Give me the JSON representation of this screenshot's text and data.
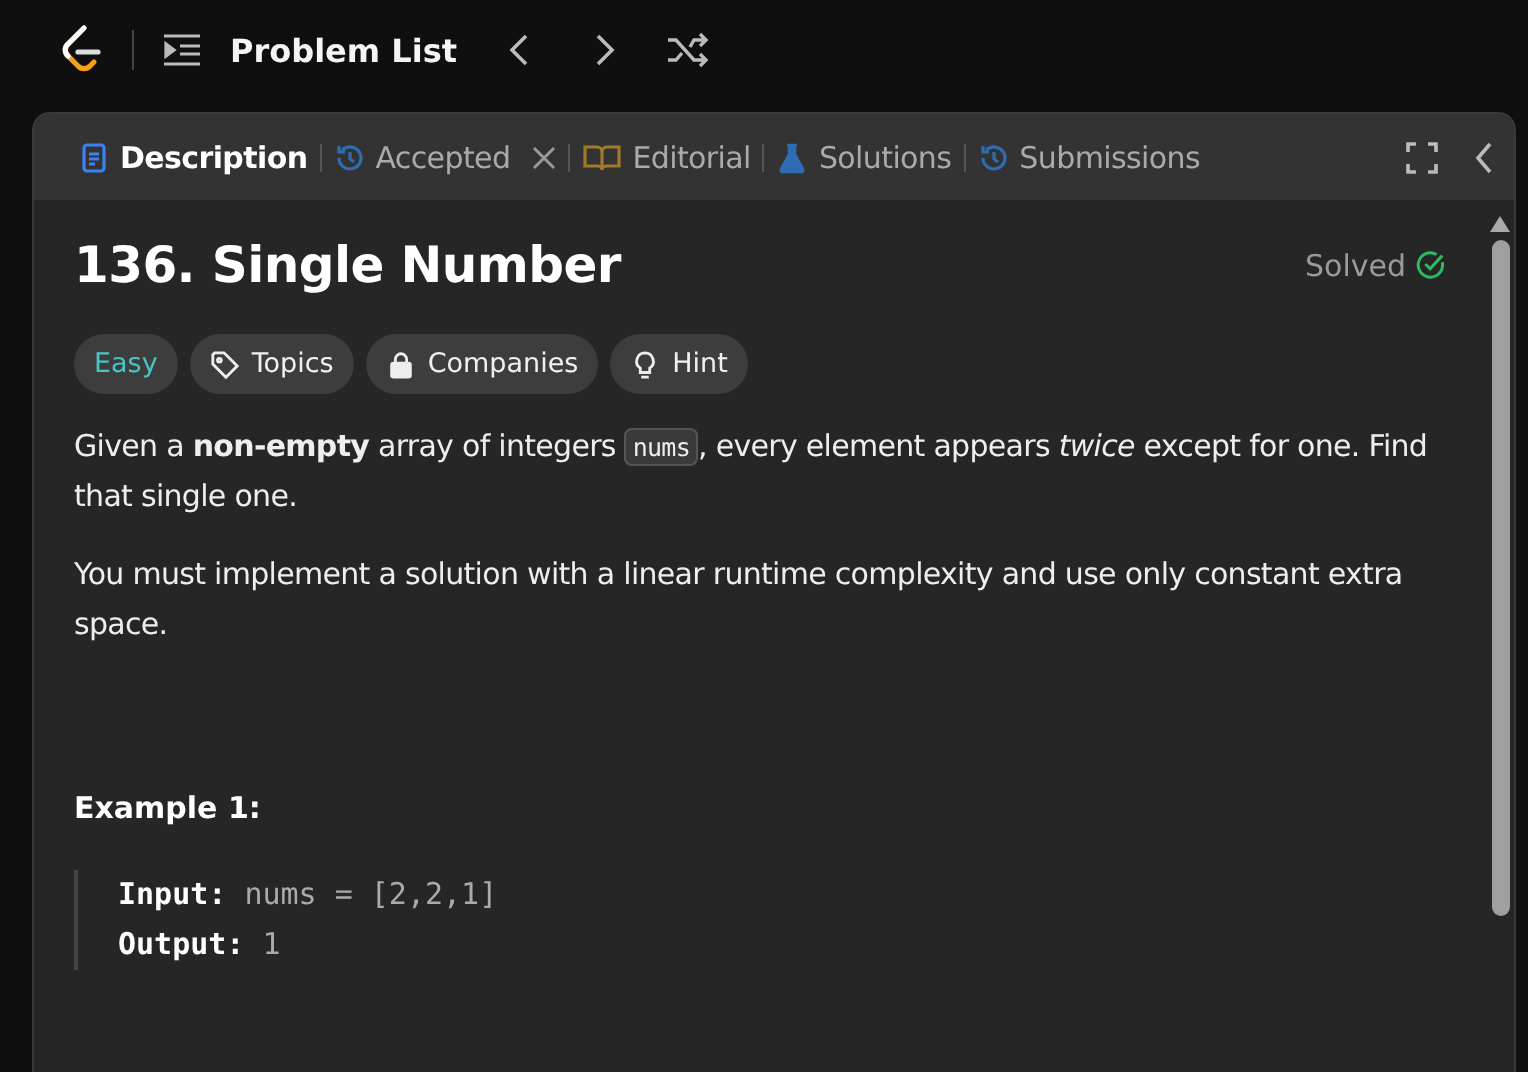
{
  "topbar": {
    "title": "Problem List"
  },
  "tabs": [
    {
      "label": "Description",
      "kind": "description",
      "selected": true,
      "closable": false
    },
    {
      "label": "Accepted",
      "kind": "history",
      "selected": false,
      "closable": true
    },
    {
      "label": "Editorial",
      "kind": "book",
      "selected": false,
      "closable": false
    },
    {
      "label": "Solutions",
      "kind": "flask",
      "selected": false,
      "closable": false
    },
    {
      "label": "Submissions",
      "kind": "history",
      "selected": false,
      "closable": false
    }
  ],
  "problem": {
    "title": "136. Single Number",
    "status": "Solved",
    "tags": [
      {
        "label": "Easy",
        "kind": "difficulty"
      },
      {
        "label": "Topics",
        "kind": "tag"
      },
      {
        "label": "Companies",
        "kind": "lock"
      },
      {
        "label": "Hint",
        "kind": "bulb"
      }
    ],
    "paragraphs": [
      [
        {
          "kind": "text",
          "text": "Given a **non-empty** array of integers "
        },
        {
          "kind": "code",
          "text": "nums"
        },
        {
          "kind": "text",
          "text": ", every element appears *twice* except for one. Find that single one."
        }
      ],
      [
        {
          "kind": "text",
          "text": "You must implement a solution with a linear runtime complexity and use only constant extra space."
        }
      ]
    ],
    "examples": [
      {
        "title": "Example 1:",
        "lines": [
          {
            "label": "Input:",
            "value": "nums = [2,2,1]"
          },
          {
            "label": "Output:",
            "value": "1"
          }
        ]
      }
    ]
  }
}
